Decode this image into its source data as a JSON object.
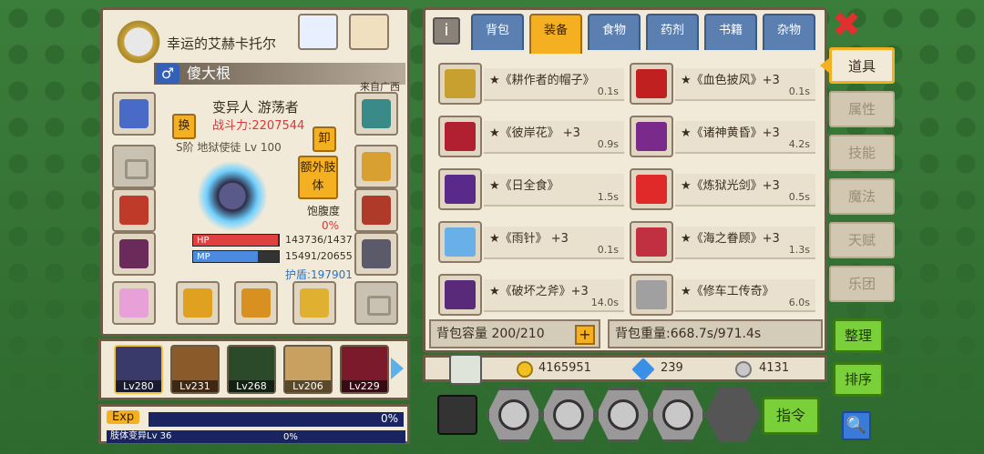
{
  "character": {
    "title": "幸运的艾赫卡托尔",
    "name": "傻大根",
    "gender_symbol": "♂",
    "origin": "来自广西",
    "class_line": "变异人 游荡者",
    "power": "战斗力:2207544",
    "rank_line": "S阶 地狱使徒 Lv 100",
    "swap_label": "换",
    "unequip_label": "卸",
    "extra_limb_label": "额外肢体",
    "hunger_label": "饱腹度",
    "hunger_value": "0%",
    "hp_label": "HP",
    "hp_text": "143736/1437",
    "mp_label": "MP",
    "mp_text": "15491/20655",
    "shield_text": "护盾:197901",
    "hp_fraction": 0.99,
    "mp_fraction": 0.75
  },
  "party": [
    {
      "level": "Lv280",
      "active": true
    },
    {
      "level": "Lv231",
      "active": false
    },
    {
      "level": "Lv268",
      "active": false
    },
    {
      "level": "Lv206",
      "active": false
    },
    {
      "level": "Lv229",
      "active": false
    }
  ],
  "exp": {
    "label": "Exp",
    "value": "0%",
    "sub_label": "肢体变异Lv 36",
    "sub_value": "0%"
  },
  "tabs": [
    {
      "label": "背包",
      "active": false
    },
    {
      "label": "装备",
      "active": true
    },
    {
      "label": "食物",
      "active": false
    },
    {
      "label": "药剂",
      "active": false
    },
    {
      "label": "书籍",
      "active": false
    },
    {
      "label": "杂物",
      "active": false
    }
  ],
  "info_label": "i",
  "items": [
    {
      "name": "★《耕作者的帽子》",
      "weight": "0.1s",
      "color": "#c8a030"
    },
    {
      "name": "★《血色披风》+3",
      "weight": "0.1s",
      "color": "#c02020"
    },
    {
      "name": "★《彼岸花》 +3",
      "weight": "0.9s",
      "color": "#b02030"
    },
    {
      "name": "★《诸神黄昏》+3",
      "weight": "4.2s",
      "color": "#7a2a8a"
    },
    {
      "name": "★《日全食》",
      "weight": "1.5s",
      "color": "#5a2a8a"
    },
    {
      "name": "★《炼狱光剑》+3",
      "weight": "0.5s",
      "color": "#e02a2a"
    },
    {
      "name": "★《雨针》 +3",
      "weight": "0.1s",
      "color": "#6ab0e8"
    },
    {
      "name": "★《海之眷顾》+3",
      "weight": "1.3s",
      "color": "#c03040"
    },
    {
      "name": "★《破坏之斧》+3",
      "weight": "14.0s",
      "color": "#5a2a7a"
    },
    {
      "name": "★《修车工传奇》",
      "weight": "6.0s",
      "color": "#a0a0a0"
    }
  ],
  "capacity": "背包容量 200/210",
  "capacity_plus": "+",
  "weight": "背包重量:668.7s/971.4s",
  "currency": {
    "gold": "4165951",
    "diamond": "239",
    "silver": "4131"
  },
  "command_label": "指令",
  "side_tabs": [
    {
      "label": "道具",
      "active": true
    },
    {
      "label": "属性",
      "active": false
    },
    {
      "label": "技能",
      "active": false
    },
    {
      "label": "魔法",
      "active": false
    },
    {
      "label": "天赋",
      "active": false
    },
    {
      "label": "乐团",
      "active": false
    }
  ],
  "sort_label": "整理",
  "order_label": "排序",
  "close_symbol": "✖",
  "search_symbol": "🔍"
}
